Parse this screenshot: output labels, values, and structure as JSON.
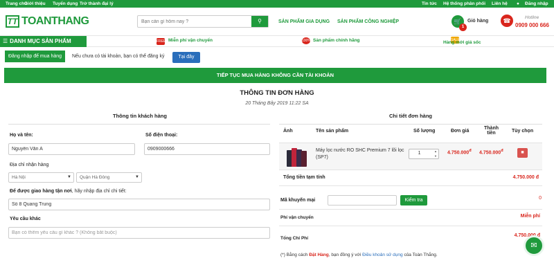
{
  "topbar": {
    "left_links": [
      "Trang chủ",
      "Giới thiệu",
      "Tuyển dụng",
      "Trở thành đại lý"
    ],
    "right_links": [
      "Tin tức",
      "Hệ thống phân phối",
      "Liên hệ"
    ],
    "login": "Đăng nhập"
  },
  "header": {
    "logo_mark": "TT",
    "logo_text": "TOANTHANG",
    "search_placeholder": "Bạn cần gì hôm nay ?",
    "nav_links": [
      "SẢN PHẨM GIA DỤNG",
      "SẢN PHẨM CÔNG NGHIỆP"
    ],
    "cart_label": "Giỏ hàng",
    "cart_count": "1",
    "hotline_label": "Hotline",
    "hotline_number": "0909 000 666"
  },
  "catbar": {
    "menu_label": "DANH MỤC SẢN PHẨM",
    "promos": [
      "Miễn phí vận chuyển",
      "Sản phẩm chính hãng",
      "Hàng mới giá sốc"
    ]
  },
  "login_row": {
    "button": "Đăng nhập để mua hàng",
    "hint": "Nếu chưa có tài khoản, bạn có thể đăng ký",
    "here_button": "Tại đây"
  },
  "continue_button": "TIẾP TỤC MUA HÀNG KHÔNG CẦN TÀI KHOẢN",
  "page": {
    "title": "THÔNG TIN ĐƠN HÀNG",
    "date": "20 Tháng Bảy 2019 11:22 SA"
  },
  "customer": {
    "section_title": "Thông tin khách hàng",
    "name_label": "Họ và tên:",
    "name_value": "Nguyễn Văn A",
    "phone_label": "Số điện thoại:",
    "phone_value": "0909000666",
    "address_label": "Địa chỉ nhận hàng",
    "city": "Hà Nội",
    "district": "Quận Hà Đông",
    "address_hint_bold": "Để được giao hàng tận nơi",
    "address_hint_rest": ", hãy nhập địa chỉ chi tiết:",
    "street_value": "Số 8 Quang Trung",
    "request_label": "Yêu cầu khác",
    "request_placeholder": "Bạn có thêm yêu cầu gì khác ? (Không bắt buộc)"
  },
  "order": {
    "section_title": "Chi tiết đơn hàng",
    "headers": {
      "image": "Ảnh",
      "product": "Tên sản phẩm",
      "quantity": "Số lượng",
      "unit_price": "Đơn giá",
      "total_line1": "Thành",
      "total_line2": "tiền",
      "options": "Tùy chọn"
    },
    "items": [
      {
        "name": "Máy lọc nước RO SHC Premium 7 lõi lọc (SP7)",
        "quantity": "1",
        "unit_price": "4.750.000",
        "total": "4.750.000",
        "currency_mark": "đ"
      }
    ],
    "subtotal_label": "Tổng tiền tạm tính",
    "subtotal_value": "4.750.000 đ",
    "coupon_label": "Mã khuyến mại",
    "coupon_button": "Kiểm tra",
    "coupon_discount": "0",
    "shipping_label": "Phí vận chuyển",
    "shipping_value": "Miễn phí",
    "total_label": "Tổng Chi Phí",
    "total_value": "4.750.000 đ",
    "terms_prefix": "(*) Bằng cách ",
    "terms_order": "Đặt Hàng",
    "terms_middle": ", bạn đồng ý với ",
    "terms_link": "Điều khoản sử dụng",
    "terms_suffix": " của Toàn Thắng."
  },
  "colors": {
    "brand_green": "#1f9a3c",
    "price_red": "#d9251c",
    "link_blue": "#2a6ebb"
  }
}
